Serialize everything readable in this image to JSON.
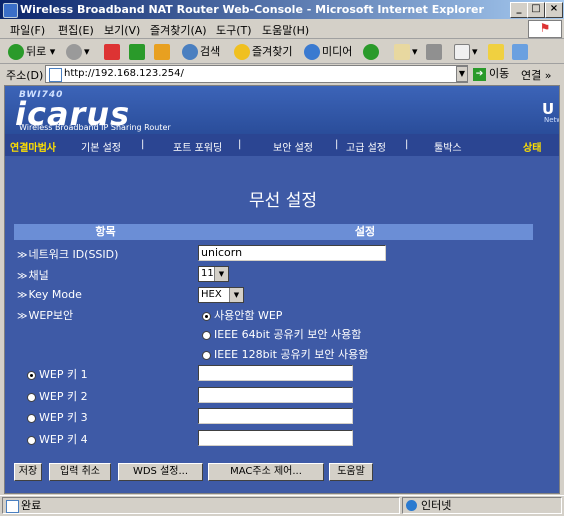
{
  "window": {
    "title": "Wireless Broadband NAT Router Web-Console - Microsoft Internet Explorer"
  },
  "menu": [
    "파일(F)",
    "편집(E)",
    "보기(V)",
    "즐겨찾기(A)",
    "도구(T)",
    "도움말(H)"
  ],
  "toolbar": {
    "back": "뒤로",
    "search": "검색",
    "favorites": "즐겨찾기",
    "media": "미디어"
  },
  "address": {
    "label": "주소(D)",
    "url": "http://192.168.123.254/",
    "go": "이동",
    "links": "연결"
  },
  "banner": {
    "small": "BWI740",
    "brand": "icarus",
    "tagline": "Wireless Broadband IP Sharing Router",
    "right": "U",
    "right_sub": "Netw"
  },
  "nav": {
    "wizard": "연결마법사",
    "basic": "기본 설정",
    "port": "포트 포워딩",
    "security": "보안 설정",
    "advanced": "고급 설정",
    "toolbox": "툴박스",
    "status": "상태",
    "sep": "|"
  },
  "page": {
    "title": "무선 설정"
  },
  "table": {
    "col_item": "항목",
    "col_setting": "설정"
  },
  "form": {
    "ssid_label": "네트워크 ID(SSID)",
    "ssid_value": "unicorn",
    "channel_label": "채널",
    "channel_value": "11",
    "keymode_label": "Key Mode",
    "keymode_value": "HEX",
    "wep_label": "WEP보안",
    "wep_opt_off": "사용안함 WEP",
    "wep_opt_64": "IEEE 64bit 공유키 보안 사용함",
    "wep_opt_128": "IEEE 128bit 공유키 보안 사용함",
    "wep_key1": "WEP 키 1",
    "wep_key2": "WEP 키 2",
    "wep_key3": "WEP 키 3",
    "wep_key4": "WEP 키 4",
    "wep_selected": "off",
    "wep_key_selected": 1
  },
  "buttons": {
    "save": "저장",
    "cancel": "입력 취소",
    "wds": "WDS 설정...",
    "mac": "MAC주소 제어...",
    "help": "도움말"
  },
  "statusbar": {
    "left": "완료",
    "zone": "인터넷"
  }
}
